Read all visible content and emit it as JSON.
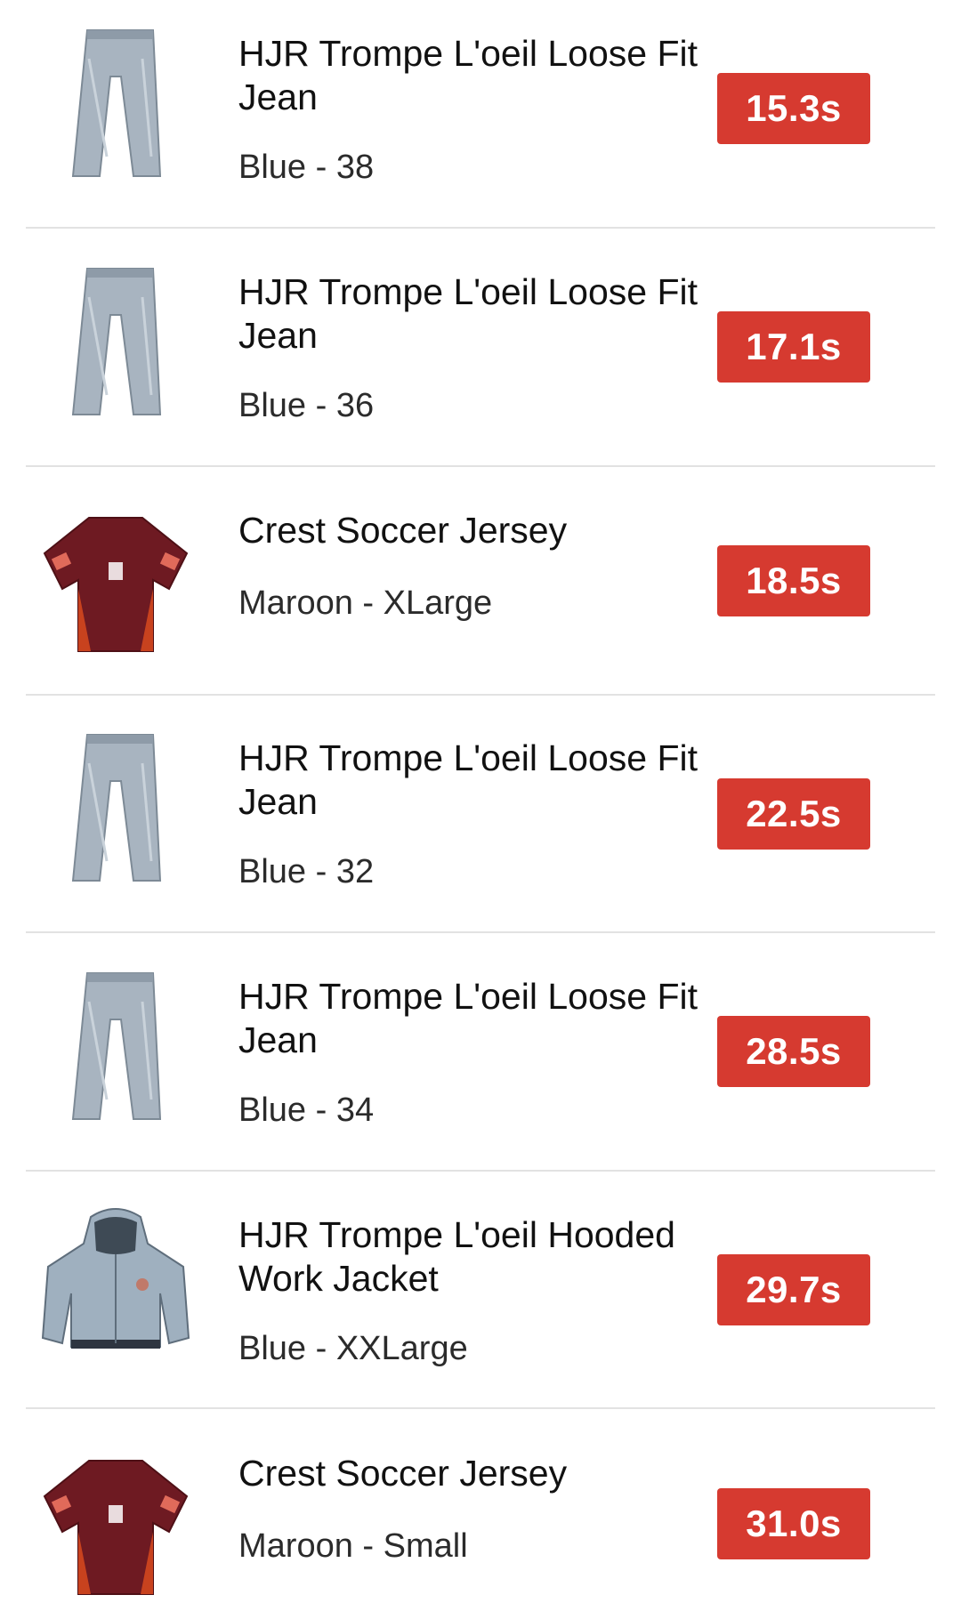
{
  "items": [
    {
      "title": "HJR Trompe L'oeil Loose Fit Jean",
      "variant": "Blue - 38",
      "time": "15.3s",
      "image": "jean"
    },
    {
      "title": "HJR Trompe L'oeil Loose Fit Jean",
      "variant": "Blue - 36",
      "time": "17.1s",
      "image": "jean"
    },
    {
      "title": "Crest Soccer Jersey",
      "variant": "Maroon - XLarge",
      "time": "18.5s",
      "image": "jersey"
    },
    {
      "title": "HJR Trompe L'oeil Loose Fit Jean",
      "variant": "Blue - 32",
      "time": "22.5s",
      "image": "jean"
    },
    {
      "title": "HJR Trompe L'oeil Loose Fit Jean",
      "variant": "Blue - 34",
      "time": "28.5s",
      "image": "jean"
    },
    {
      "title": "HJR Trompe L'oeil Hooded Work Jacket",
      "variant": "Blue - XXLarge",
      "time": "29.7s",
      "image": "jacket"
    },
    {
      "title": "Crest Soccer Jersey",
      "variant": "Maroon - Small",
      "time": "31.0s",
      "image": "jersey"
    }
  ],
  "colors": {
    "badge": "#d63a30",
    "separator": "#e2e2e2"
  }
}
